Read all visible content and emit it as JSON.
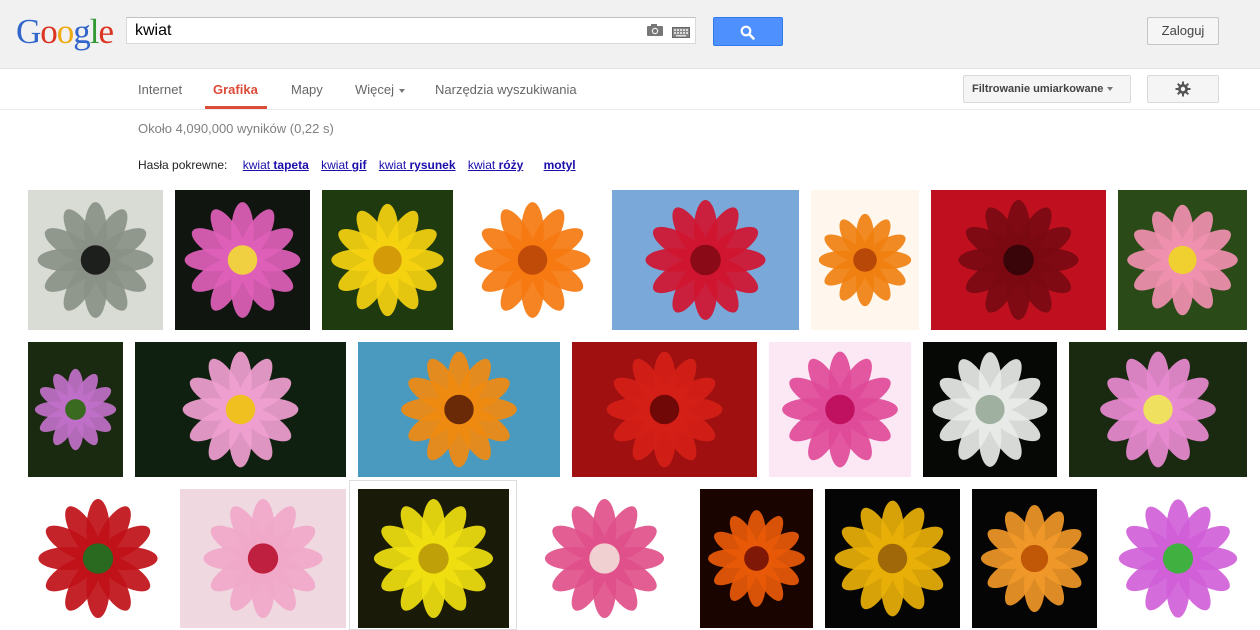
{
  "logo": {
    "letters": [
      "G",
      "o",
      "o",
      "g",
      "l",
      "e"
    ],
    "colors": [
      "#3366cc",
      "#dd3322",
      "#eeaa11",
      "#3366cc",
      "#339933",
      "#dd3322"
    ]
  },
  "search": {
    "query": "kwiat",
    "camera_icon": "camera-icon",
    "keyboard_icon": "keyboard-icon",
    "button_icon": "search-icon"
  },
  "header": {
    "signin_label": "Zaloguj"
  },
  "nav": {
    "tabs": [
      {
        "label": "Internet",
        "active": false
      },
      {
        "label": "Grafika",
        "active": true
      },
      {
        "label": "Mapy",
        "active": false
      },
      {
        "label": "Więcej",
        "active": false,
        "dropdown": true
      },
      {
        "label": "Narzędzia wyszukiwania",
        "active": false
      }
    ],
    "safesearch_label": "Filtrowanie umiarkowane",
    "settings_icon": "gear-icon"
  },
  "results": {
    "stats": "Około 4,090,000 wyników (0,22 s)",
    "related_label": "Hasła pokrewne:",
    "related": [
      {
        "prefix": "kwiat",
        "bold": "tapeta"
      },
      {
        "prefix": "kwiat",
        "bold": "gif"
      },
      {
        "prefix": "kwiat",
        "bold": "rysunek"
      },
      {
        "prefix": "kwiat",
        "bold": "róży"
      },
      {
        "prefix": "",
        "bold": "motyl"
      }
    ]
  },
  "thumbnails": [
    {
      "id": "t1",
      "flower": "grey-sunflower",
      "bg": "#d8dcd4",
      "petal": "#8a9086",
      "center": "#1d1f1c"
    },
    {
      "id": "t2",
      "flower": "pink-water-lily",
      "bg": "#101510",
      "petal": "#e060b8",
      "center": "#f0d040"
    },
    {
      "id": "t3",
      "flower": "yellow-daisy",
      "bg": "#203a10",
      "petal": "#f5d310",
      "center": "#d49a08"
    },
    {
      "id": "t4",
      "flower": "orange-gerbera",
      "bg": "#ffffff",
      "petal": "#f57a10",
      "center": "#c04a08"
    },
    {
      "id": "t5",
      "flower": "red-rose",
      "bg": "#7aa8d8",
      "petal": "#d01530",
      "center": "#8a0a18"
    },
    {
      "id": "t6",
      "flower": "orange-gerbera-drops",
      "bg": "#fff6ee",
      "petal": "#f08010",
      "center": "#b84808"
    },
    {
      "id": "t7",
      "flower": "dark-red-rose",
      "bg": "#c01020",
      "petal": "#7a0a12",
      "center": "#3a0508"
    },
    {
      "id": "t8",
      "flower": "pink-camellia",
      "bg": "#2a4a18",
      "petal": "#f090b0",
      "center": "#f0d030"
    },
    {
      "id": "t9",
      "flower": "purple-buds",
      "bg": "#1a2a10",
      "petal": "#c070c8",
      "center": "#3a6a20"
    },
    {
      "id": "t10",
      "flower": "pink-wild-rose",
      "bg": "#102010",
      "petal": "#f0a0d0",
      "center": "#f0c020"
    },
    {
      "id": "t11",
      "flower": "orange-gerbera-macro",
      "bg": "#4a9ac0",
      "petal": "#f08a10",
      "center": "#6a2a08"
    },
    {
      "id": "t12",
      "flower": "red-rose-close",
      "bg": "#a01010",
      "petal": "#d42018",
      "center": "#700808"
    },
    {
      "id": "t13",
      "flower": "pink-star-flower",
      "bg": "#fbe8f4",
      "petal": "#e04a98",
      "center": "#c01060"
    },
    {
      "id": "t14",
      "flower": "white-lilies",
      "bg": "#050805",
      "petal": "#e8ece8",
      "center": "#a0b0a0"
    },
    {
      "id": "t15",
      "flower": "pink-lily",
      "bg": "#1a2a10",
      "petal": "#e88ad0",
      "center": "#f0e060"
    },
    {
      "id": "t16",
      "flower": "single-red-rose",
      "bg": "#ffffff",
      "petal": "#c01018",
      "center": "#2a6a20"
    },
    {
      "id": "t17",
      "flower": "pink-hibiscus",
      "bg": "#f0d8e0",
      "petal": "#f0a8c8",
      "center": "#c02040"
    },
    {
      "id": "t18",
      "flower": "yellow-adonis",
      "bg": "#1a1a08",
      "petal": "#f0e010",
      "center": "#c0a008"
    },
    {
      "id": "t19",
      "flower": "pink-orchid",
      "bg": "#ffffff",
      "petal": "#e0508a",
      "center": "#f0d0d0"
    },
    {
      "id": "t20",
      "flower": "fire-gerbera",
      "bg": "#1a0400",
      "petal": "#e85a08",
      "center": "#801808"
    },
    {
      "id": "t21",
      "flower": "yellow-rose",
      "bg": "#050505",
      "petal": "#e8b008",
      "center": "#a06808"
    },
    {
      "id": "t22",
      "flower": "orange-rose",
      "bg": "#050505",
      "petal": "#f09828",
      "center": "#c05808"
    },
    {
      "id": "t23",
      "flower": "glitter-lotus",
      "bg": "#ffffff",
      "petal": "#d060d8",
      "center": "#40b040"
    }
  ]
}
